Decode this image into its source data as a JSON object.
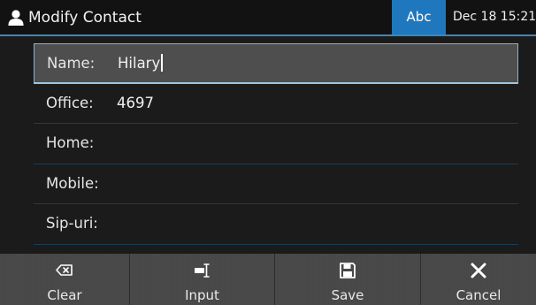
{
  "title_bar": {
    "title": "Modify Contact",
    "icon": "person-icon",
    "input_mode": "Abc",
    "datetime": "Dec 18 15:21"
  },
  "form": {
    "fields": [
      {
        "label": "Name:",
        "value": "Hilary",
        "focused": true
      },
      {
        "label": "Office:",
        "value": "4697",
        "focused": false
      },
      {
        "label": "Home:",
        "value": "",
        "focused": false
      },
      {
        "label": "Mobile:",
        "value": "",
        "focused": false
      },
      {
        "label": "Sip-uri:",
        "value": "",
        "focused": false
      }
    ]
  },
  "softkeys": [
    {
      "label": "Clear",
      "icon": "backspace-icon"
    },
    {
      "label": "Input",
      "icon": "input-method-icon"
    },
    {
      "label": "Save",
      "icon": "save-icon"
    },
    {
      "label": "Cancel",
      "icon": "close-icon"
    }
  ],
  "colors": {
    "accent": "#1f78bd",
    "title_underline": "#3f87b6",
    "background": "#1b1b1b",
    "focused_field": "#4e4e4e",
    "softkey_bar": "#4a4a4a"
  }
}
